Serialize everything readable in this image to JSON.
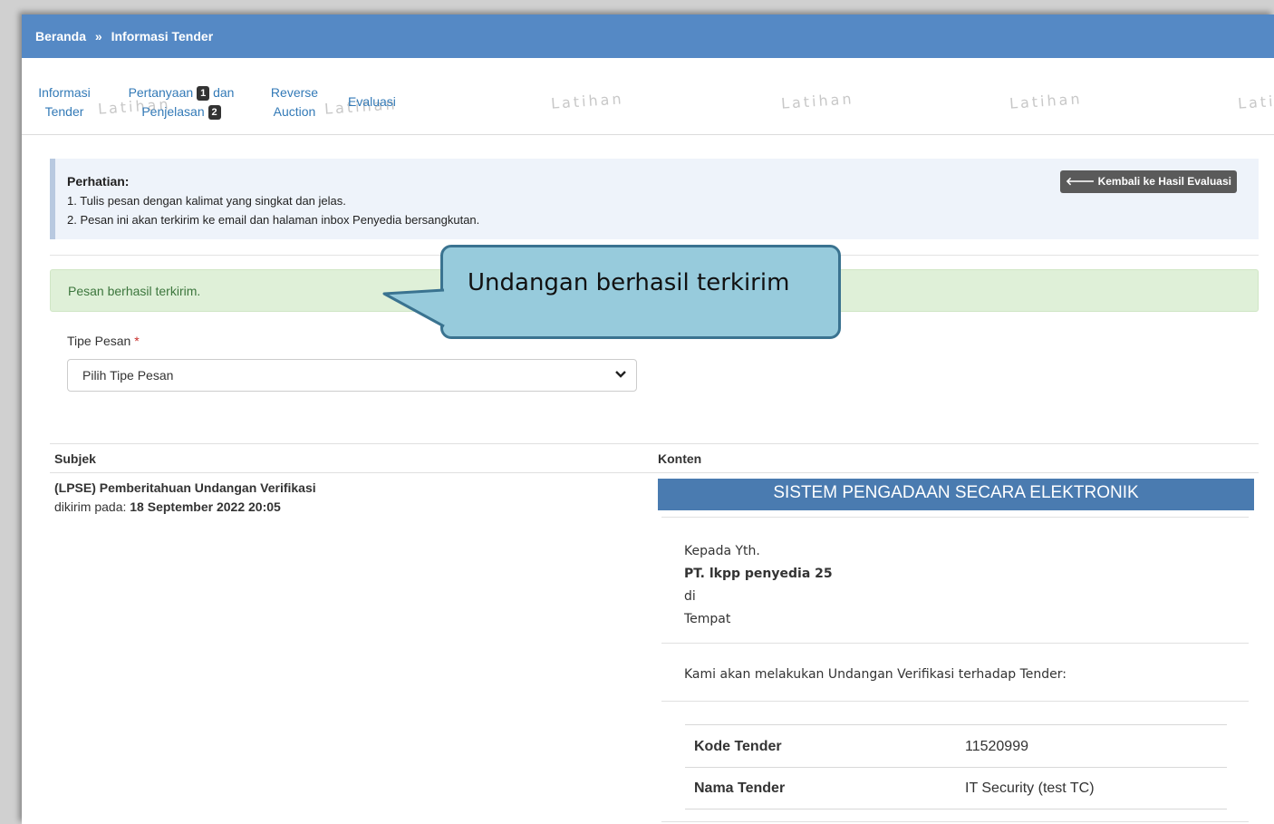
{
  "breadcrumb": {
    "home": "Beranda",
    "separator": "»",
    "current": "Informasi Tender"
  },
  "tabs": {
    "info_line1": "Informasi",
    "info_line2": "Tender",
    "pertanyaan_line1": "Pertanyaan",
    "pertanyaan_badge": "1",
    "pertanyaan_and": "dan",
    "penjelasan": "Penjelasan",
    "penjelasan_badge": "2",
    "reverse_line1": "Reverse",
    "reverse_line2": "Auction",
    "evaluasi": "Evaluasi"
  },
  "watermark": "Latihan",
  "notice": {
    "title": "Perhatian:",
    "line1": "1. Tulis pesan dengan kalimat yang singkat dan jelas.",
    "line2": "2. Pesan ini akan terkirim ke email dan halaman inbox Penyedia bersangkutan.",
    "back_button": "Kembali ke Hasil Evaluasi"
  },
  "alert": {
    "text": "Pesan berhasil terkirim."
  },
  "callout": {
    "text": "Undangan berhasil terkirim"
  },
  "form": {
    "tipe_label": "Tipe Pesan",
    "required_mark": "*",
    "tipe_value": "Pilih Tipe Pesan"
  },
  "table": {
    "col_subject": "Subjek",
    "col_content": "Konten",
    "row": {
      "subject": "(LPSE) Pemberitahuan Undangan Verifikasi",
      "sent_prefix": "dikirim pada:",
      "sent_date": "18 September 2022 20:05"
    }
  },
  "email": {
    "header": "SISTEM PENGADAAN SECARA ELEKTRONIK",
    "to_prefix": "Kepada Yth.",
    "recipient": "PT. lkpp penyedia 25",
    "di": "di",
    "place": "Tempat",
    "intro": "Kami akan melakukan Undangan Verifikasi terhadap Tender:",
    "kode_label": "Kode Tender",
    "kode_value": "11520999",
    "nama_label": "Nama Tender",
    "nama_value": "IT Security (test TC)"
  },
  "colors": {
    "topbar": "#5589c5",
    "link": "#337ab7",
    "alert_bg": "#dff0d8",
    "callout_bg": "#97cbdc",
    "email_header": "#4a7bb0"
  }
}
